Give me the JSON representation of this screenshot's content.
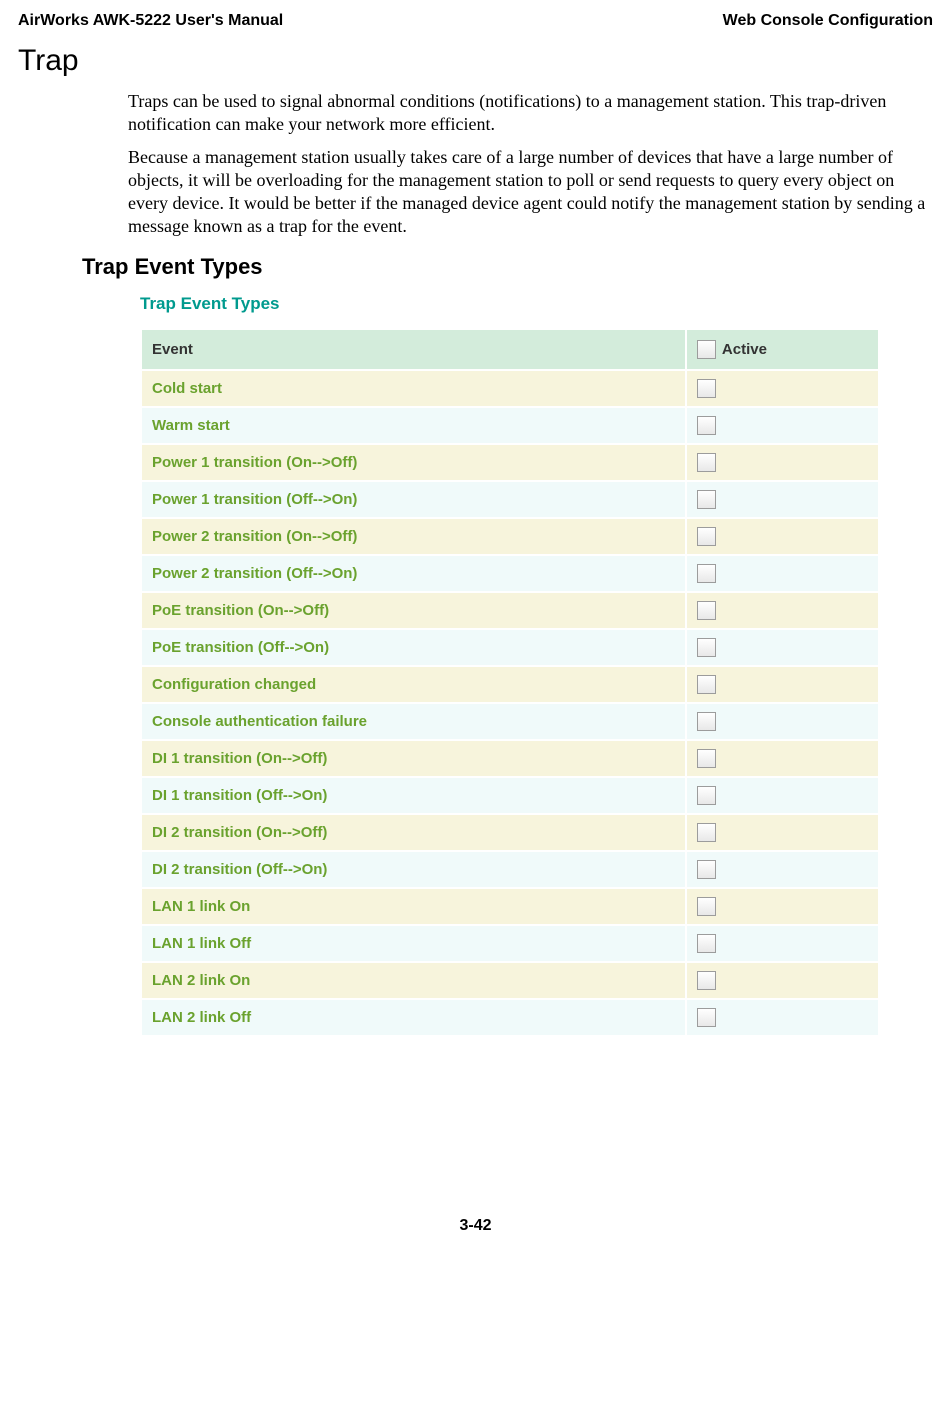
{
  "header": {
    "left": "AirWorks AWK-5222 User's Manual",
    "right": "Web Console Configuration"
  },
  "section": {
    "h1": "Trap",
    "p1": "Traps can be used to signal abnormal conditions (notifications) to a management station. This trap-driven notification can make your network more efficient.",
    "p2": "Because a management station usually takes care of a large number of devices that have a large number of objects, it will be overloading for the management station to poll or send requests to query every object on every device. It would be better if the managed device agent could notify the management station by sending a message known as a trap for the event.",
    "h2": "Trap Event Types"
  },
  "trapTable": {
    "title": "Trap Event Types",
    "header": {
      "event": "Event",
      "active": "Active"
    },
    "rows": [
      {
        "label": "Cold start"
      },
      {
        "label": "Warm start"
      },
      {
        "label": "Power 1 transition (On-->Off)"
      },
      {
        "label": "Power 1 transition (Off-->On)"
      },
      {
        "label": "Power 2 transition (On-->Off)"
      },
      {
        "label": "Power 2 transition (Off-->On)"
      },
      {
        "label": "PoE transition (On-->Off)"
      },
      {
        "label": "PoE transition (Off-->On)"
      },
      {
        "label": "Configuration changed"
      },
      {
        "label": "Console authentication failure"
      },
      {
        "label": "DI 1 transition (On-->Off)"
      },
      {
        "label": "DI 1 transition (Off-->On)"
      },
      {
        "label": "DI 2 transition (On-->Off)"
      },
      {
        "label": "DI 2 transition (Off-->On)"
      },
      {
        "label": "LAN 1 link On"
      },
      {
        "label": "LAN 1 link Off"
      },
      {
        "label": "LAN 2 link On"
      },
      {
        "label": "LAN 2 link Off"
      }
    ]
  },
  "footer": "3-42"
}
